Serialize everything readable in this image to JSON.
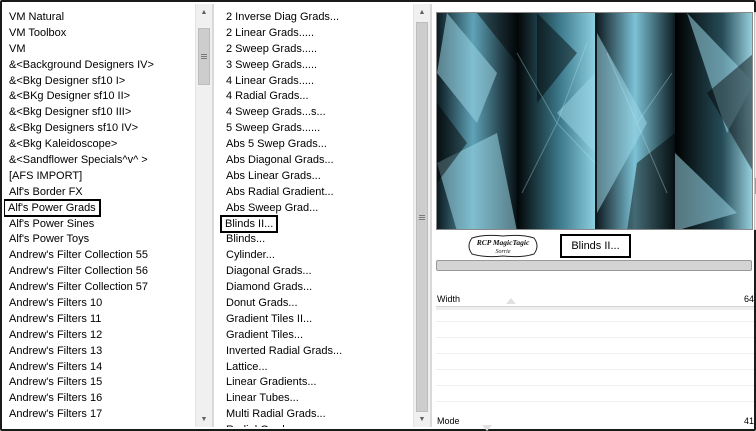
{
  "left_list": {
    "items": [
      "VM Natural",
      "VM Toolbox",
      "VM",
      "&<Background Designers IV>",
      "&<Bkg Designer sf10 I>",
      "&<BKg Designer sf10 II>",
      "&<Bkg Designer sf10 III>",
      "&<Bkg Designers sf10 IV>",
      "&<Bkg Kaleidoscope>",
      "&<Sandflower Specials^v^ >",
      "[AFS IMPORT]",
      "Alf's Border FX",
      "Alf's Power Grads",
      "Alf's Power Sines",
      "Alf's Power Toys",
      "Andrew's Filter Collection 55",
      "Andrew's Filter Collection 56",
      "Andrew's Filter Collection 57",
      "Andrew's Filters 10",
      "Andrew's Filters 11",
      "Andrew's Filters 12",
      "Andrew's Filters 13",
      "Andrew's Filters 14",
      "Andrew's Filters 15",
      "Andrew's Filters 16",
      "Andrew's Filters 17"
    ],
    "selected_index": 12
  },
  "mid_list": {
    "items": [
      "2 Inverse Diag Grads...",
      "2 Linear Grads.....",
      "2 Sweep Grads.....",
      "3 Sweep Grads.....",
      "4 Linear Grads.....",
      "4 Radial Grads...",
      "4 Sweep Grads...s...",
      "5 Sweep Grads......",
      "Abs 5 Swep Grads...",
      "Abs Diagonal Grads...",
      "Abs Linear Grads...",
      "Abs Radial Gradient...",
      "Abs Sweep Grad...",
      "Blinds II...",
      "Blinds...",
      "Cylinder...",
      "Diagonal Grads...",
      "Diamond Grads...",
      "Donut Grads...",
      "Gradient Tiles II...",
      "Gradient Tiles...",
      "Inverted Radial Grads...",
      "Lattice...",
      "Linear Gradients...",
      "Linear Tubes...",
      "Multi Radial Grads...",
      "Radial Grads..."
    ],
    "selected_index": 13
  },
  "right_panel": {
    "logo_text_line1": "RCP MagicTagic",
    "logo_text_line2": "Sorrie",
    "effect_name": "Blinds II...",
    "sliders": [
      {
        "label": "Width",
        "value": "64",
        "fraction": 0.235
      },
      {
        "label": "Mode",
        "value": "41",
        "fraction": 0.16
      }
    ]
  },
  "icons": {
    "scroll_up": "scroll-up-arrow-icon",
    "scroll_down": "scroll-down-arrow-icon",
    "scroll_grip": "scroll-grip-icon"
  },
  "colors": {
    "preview_dark": "#020607",
    "preview_teal": "#6fb4c8",
    "selection_outline": "#000000"
  }
}
